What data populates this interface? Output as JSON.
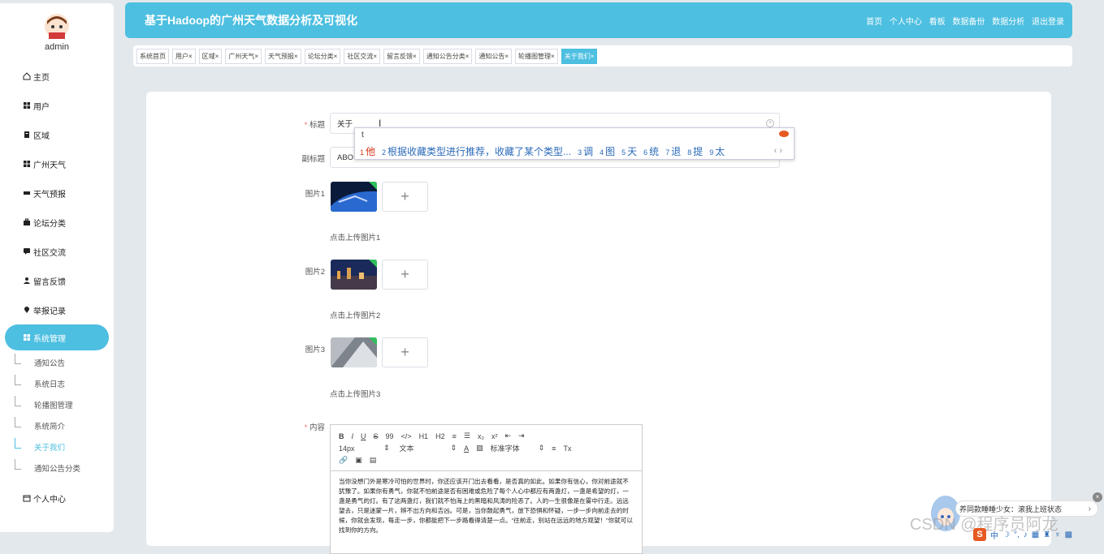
{
  "sidebar": {
    "username": "admin",
    "items": [
      {
        "label": "主页",
        "icon": "home-icon"
      },
      {
        "label": "用户",
        "icon": "grid-icon"
      },
      {
        "label": "区域",
        "icon": "clipboard-icon"
      },
      {
        "label": "广州天气",
        "icon": "grid-icon"
      },
      {
        "label": "天气预报",
        "icon": "ticket-icon"
      },
      {
        "label": "论坛分类",
        "icon": "briefcase-icon"
      },
      {
        "label": "社区交流",
        "icon": "chat-icon"
      },
      {
        "label": "留言反馈",
        "icon": "user-icon"
      },
      {
        "label": "举报记录",
        "icon": "pin-icon"
      },
      {
        "label": "系统管理",
        "icon": "grid-icon"
      }
    ],
    "sub_items": [
      "通知公告",
      "系统日志",
      "轮播图管理",
      "系统简介",
      "关于我们",
      "通知公告分类"
    ],
    "personal": "个人中心"
  },
  "header": {
    "title": "基于Hadoop的广州天气数据分析及可视化",
    "nav": [
      "首页",
      "个人中心",
      "看板",
      "数据备份",
      "数据分析",
      "退出登录"
    ]
  },
  "tabs": [
    "系统首页",
    "用户×",
    "区域×",
    "广州天气×",
    "天气预报×",
    "论坛分类×",
    "社区交流×",
    "留言反馈×",
    "通知公告分类×",
    "通知公告×",
    "轮播图管理×",
    "关于我们×"
  ],
  "form": {
    "title_label": "标题",
    "title_value": "关于",
    "subtitle_label": "副标题",
    "subtitle_value": "ABO",
    "image1_label": "图片1",
    "image1_hint": "点击上传图片1",
    "image2_label": "图片2",
    "image2_hint": "点击上传图片2",
    "image3_label": "图片3",
    "image3_hint": "点击上传图片3",
    "content_label": "内容",
    "upload_plus": "+"
  },
  "ime": {
    "typed": "t",
    "candidates": [
      {
        "n": "1",
        "text": "他"
      },
      {
        "n": "2",
        "text": "根据收藏类型进行推荐，收藏了某个类型..."
      },
      {
        "n": "3",
        "text": "调"
      },
      {
        "n": "4",
        "text": "图"
      },
      {
        "n": "5",
        "text": "天"
      },
      {
        "n": "6",
        "text": "统"
      },
      {
        "n": "7",
        "text": "退"
      },
      {
        "n": "8",
        "text": "提"
      },
      {
        "n": "9",
        "text": "太"
      }
    ],
    "pager": "‹ ›"
  },
  "editor": {
    "toolbar_row1": [
      "B",
      "I",
      "U",
      "S",
      "99",
      "</>",
      "H1",
      "H2",
      "≡",
      "☰",
      "x₂",
      "x²",
      "⇤",
      "⇥"
    ],
    "font_size": "14px",
    "block_type": "文本",
    "font_family": "标准字体",
    "toolbar_row2_extra": [
      "A",
      "▨",
      "≡",
      "Tx"
    ],
    "content": "当你没想门外是寒冷可怕的世界时，你还应该开门出去看看，是否真的如此。如果你有信心，你对前途就不犹豫了。如果你有勇气，你就不怕前途是否有困难或危险了每个人心中都应有两盏灯，一盏是希望的灯，一盏是勇气的灯。有了这两盏灯，我们就不怕海上的黑暗和风涛的险恶了。人的一生很像是在雾中行走。远远望去，只是迷蒙一片，辨不出方向和吉凶。可是，当你鼓起勇气，放下恐惧和怀疑，一步一步向前走去的时候，你就会发现，每走一步，你都能把下一步路看得清楚一点。“往前走，别站在远远的地方观望！”你就可以找到你的方向。"
  },
  "widget": {
    "bubble_text": "养同款睡睡少女：滚我上班状态",
    "arrow": "›",
    "watermark": "CSDN @程序员阿龙",
    "tray_cn": "中",
    "sogou": "S",
    "close": "×"
  },
  "colors": {
    "accent": "#4dbfe0",
    "required": "#f56c6c",
    "ime_first": "#d6361c",
    "ime_text": "#2a6ab8"
  }
}
